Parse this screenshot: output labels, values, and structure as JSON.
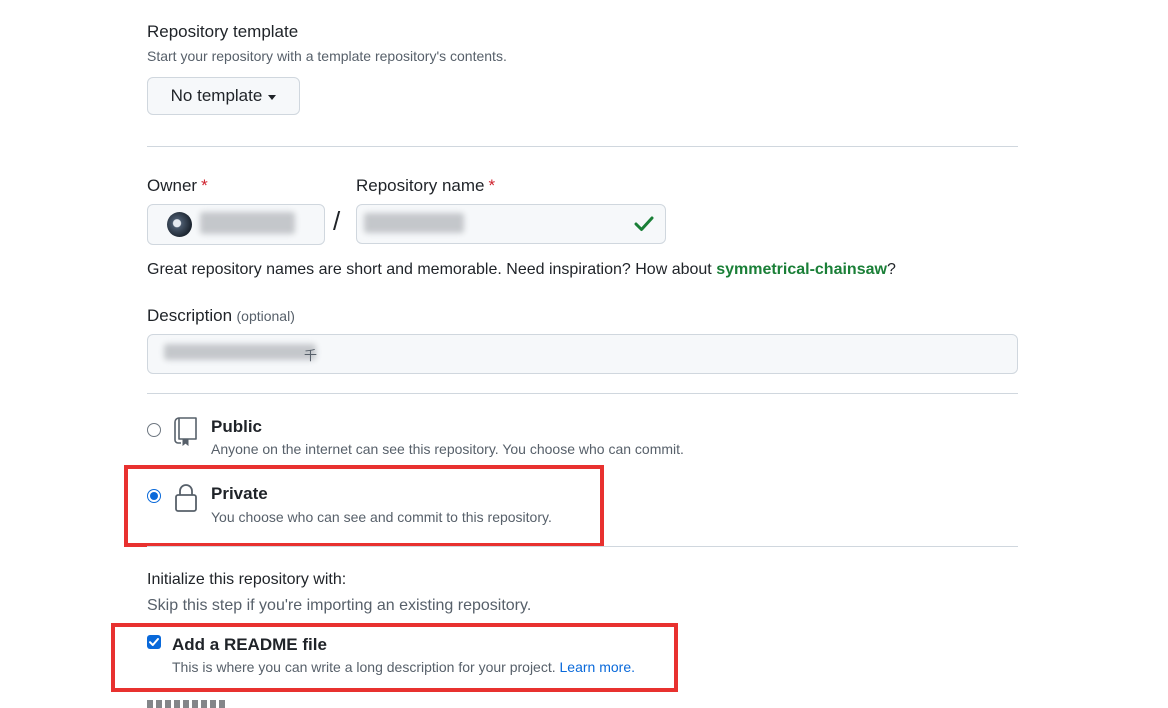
{
  "template_section": {
    "label": "Repository template",
    "description": "Start your repository with a template repository's contents.",
    "button_label": "No template"
  },
  "owner": {
    "label": "Owner",
    "required_mark": "*"
  },
  "repo_name": {
    "label": "Repository name",
    "required_mark": "*",
    "separator": "/"
  },
  "hint": {
    "text": "Great repository names are short and memorable. Need inspiration? How about ",
    "suggestion": "symmetrical-chainsaw",
    "suffix": "?"
  },
  "description_field": {
    "label": "Description",
    "optional": "(optional)",
    "visible_char": "千"
  },
  "visibility": {
    "public": {
      "title": "Public",
      "description": "Anyone on the internet can see this repository. You choose who can commit.",
      "selected": false
    },
    "private": {
      "title": "Private",
      "description": "You choose who can see and commit to this repository.",
      "selected": true
    }
  },
  "initialize": {
    "heading": "Initialize this repository with:",
    "subheading": "Skip this step if you're importing an existing repository.",
    "readme": {
      "title": "Add a README file",
      "description": "This is where you can write a long description for your project. ",
      "link": "Learn more.",
      "checked": true
    }
  },
  "colors": {
    "accent": "#0969da",
    "success": "#1a7f37",
    "annotation": "#e8312f",
    "required": "#cf222e"
  }
}
